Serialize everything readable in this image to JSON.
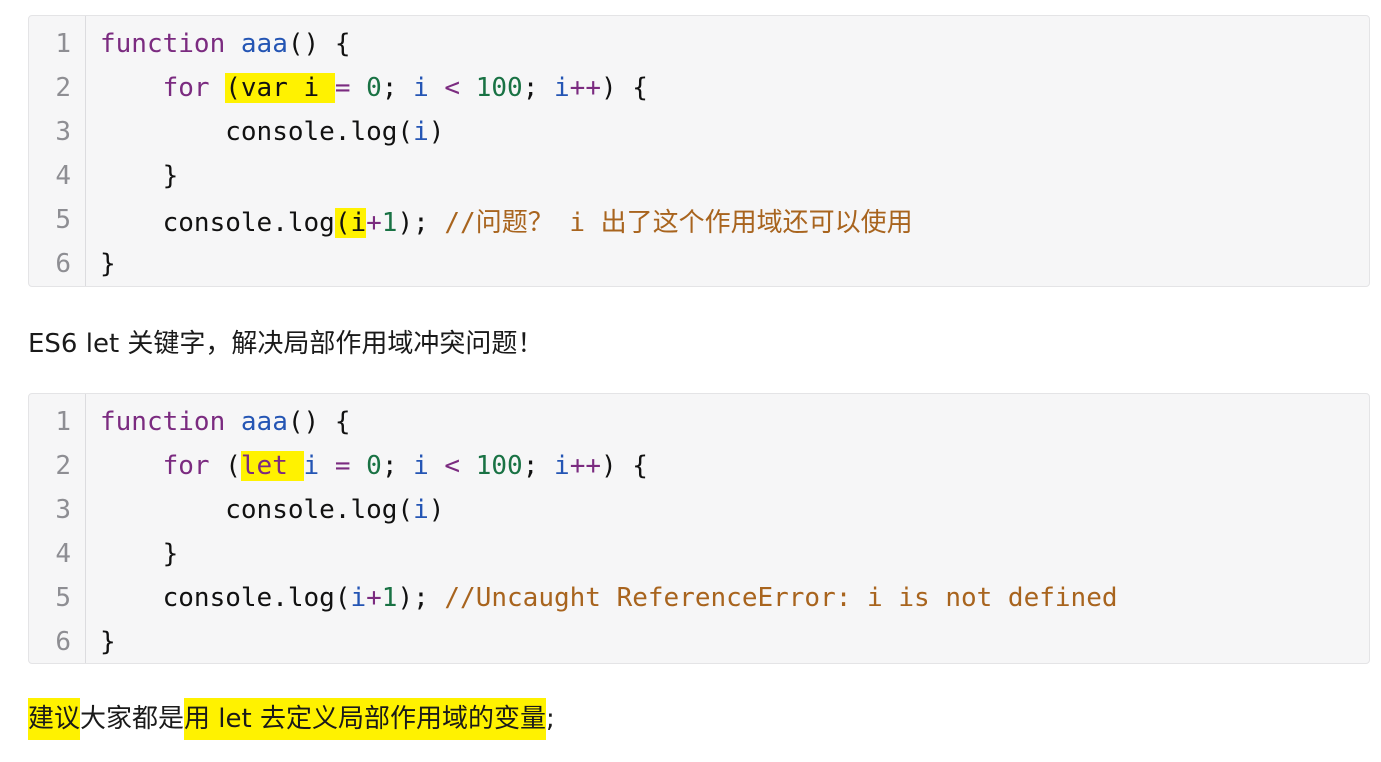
{
  "code_block_1": {
    "line_numbers": [
      "1",
      "2",
      "3",
      "4",
      "5",
      "6"
    ],
    "line1": {
      "kw": "function",
      "name": "aaa",
      "rest": "() {"
    },
    "line2": {
      "kw": "for",
      "paren_hl": "(var i ",
      "eq": "= ",
      "zero": "0",
      "semi1": "; ",
      "i1": "i",
      "lt": " < ",
      "hundred": "100",
      "semi2": "; ",
      "i2": "i",
      "inc": "++",
      "close": ") {"
    },
    "line3": {
      "text": "console.log(",
      "i": "i",
      "close": ")"
    },
    "line4": {
      "text": "}"
    },
    "line5": {
      "text": "console.log",
      "hl": "(i",
      "plus": "+",
      "one": "1",
      "close": ");",
      "comment": "//问题？ i 出了这个作用域还可以使用"
    },
    "line6": {
      "text": "}"
    }
  },
  "paragraph_1": "ES6 let 关键字，解决局部作用域冲突问题！",
  "code_block_2": {
    "line_numbers": [
      "1",
      "2",
      "3",
      "4",
      "5",
      "6"
    ],
    "line1": {
      "kw": "function",
      "name": "aaa",
      "rest": "() {"
    },
    "line2": {
      "kw": "for",
      "open": " (",
      "let_hl": "let ",
      "i0": "i",
      "eq": " = ",
      "zero": "0",
      "semi1": "; ",
      "i1": "i",
      "lt": " < ",
      "hundred": "100",
      "semi2": "; ",
      "i2": "i",
      "inc": "++",
      "close": ") {"
    },
    "line3": {
      "text": "console.log(",
      "i": "i",
      "close": ")"
    },
    "line4": {
      "text": "}"
    },
    "line5": {
      "text": "console.log(",
      "i": "i",
      "plus": "+",
      "one": "1",
      "close": ");",
      "comment": "//Uncaught ReferenceError: i is not defined"
    },
    "line6": {
      "text": "}"
    }
  },
  "paragraph_2": {
    "hl1": "建议",
    "plain": "大家都是",
    "hl2": "用 let 去定义局部作用域的变量",
    "end": ";"
  }
}
